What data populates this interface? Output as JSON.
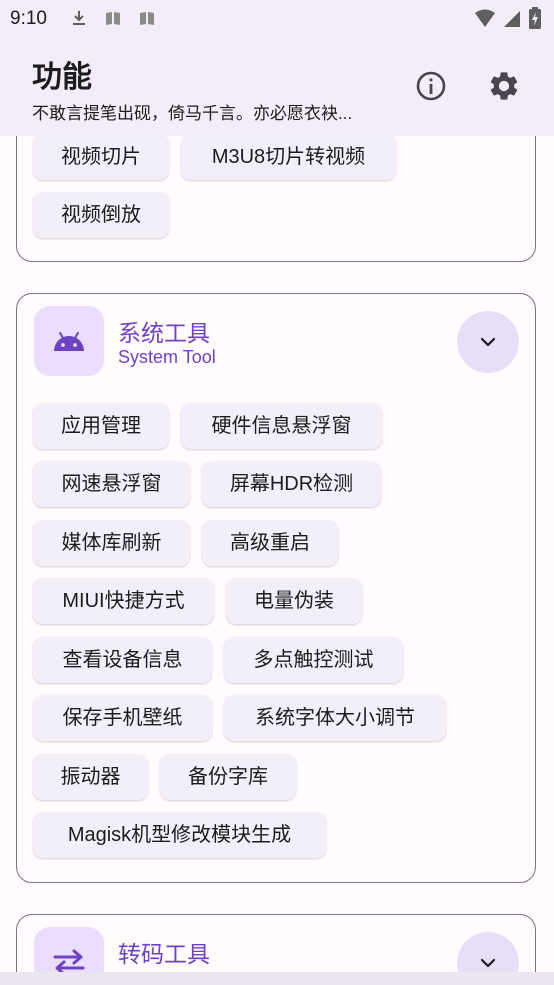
{
  "status_bar": {
    "time": "9:10",
    "icons": [
      "download-icon",
      "book-icon",
      "book-icon",
      "wifi-icon",
      "signal-icon",
      "battery-charging-icon"
    ]
  },
  "header": {
    "title": "功能",
    "subtitle": "不敢言提笔出砚，倚马千言。亦必愿衣袂...",
    "info_icon": "info-icon",
    "settings_icon": "settings-gear-icon"
  },
  "video_card": {
    "chips": [
      "视频切片",
      "M3U8切片转视频",
      "视频倒放"
    ]
  },
  "system_card": {
    "icon": "android-icon",
    "title": "系统工具",
    "subtitle": "System Tool",
    "expand_icon": "chevron-down-icon",
    "chips": [
      "应用管理",
      "硬件信息悬浮窗",
      "网速悬浮窗",
      "屏幕HDR检测",
      "媒体库刷新",
      "高级重启",
      "MIUI快捷方式",
      "电量伪装",
      "查看设备信息",
      "多点触控测试",
      "保存手机壁纸",
      "系统字体大小调节",
      "振动器",
      "备份字库",
      "Magisk机型修改模块生成"
    ]
  },
  "transcode_card": {
    "icon": "swap-arrows-icon",
    "title": "转码工具",
    "expand_icon": "chevron-down-icon"
  },
  "colors": {
    "accent": "#6f42c1",
    "surface": "#f3edf7",
    "chip_bg": "#f3eff9",
    "icon_bg": "#eaddff"
  }
}
